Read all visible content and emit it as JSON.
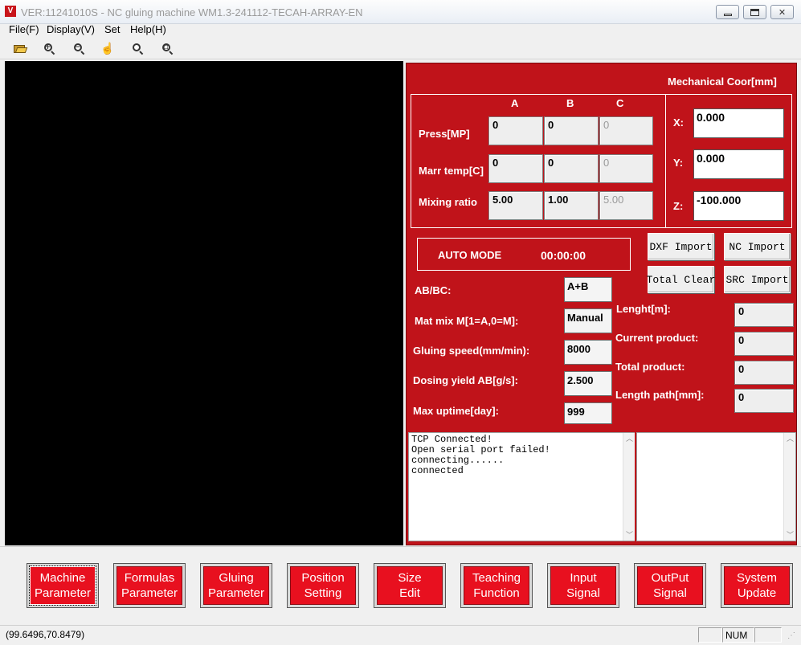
{
  "window": {
    "title": "VER:11241010S - NC gluing machine WM1.3-241112-TECAH-ARRAY-EN",
    "logo_letter": "V"
  },
  "menu": [
    "File(F)",
    "Display(V)",
    "Set",
    "Help(H)"
  ],
  "toolbar": [
    "open-folder-icon",
    "zoom-in-icon",
    "zoom-out-icon",
    "pan-hand-icon",
    "zoom-fit-icon",
    "zoom-window-icon"
  ],
  "mech": {
    "title": "Mechanical Coor[mm]",
    "x_label": "X:",
    "x": "0.000",
    "y_label": "Y:",
    "y": "0.000",
    "z_label": "Z:",
    "z": "-100.000"
  },
  "params": {
    "col_a": "A",
    "col_b": "B",
    "col_c": "C",
    "press_label": "Press[MP]",
    "press": [
      "0",
      "0",
      "0"
    ],
    "temp_label": "Marr temp[C]",
    "temp": [
      "0",
      "0",
      "0"
    ],
    "ratio_label": "Mixing ratio",
    "ratio": [
      "5.00",
      "1.00",
      "5.00"
    ]
  },
  "mode": {
    "label": "AUTO MODE",
    "time": "00:00:00"
  },
  "imports": {
    "dxf": "DXF Import",
    "nc": "NC Import",
    "total_clear": "Total Clear",
    "src": "SRC Import"
  },
  "settings": {
    "abbc_label": "AB/BC:",
    "abbc": "A+B",
    "matmix_label": "Mat mix M[1=A,0=M]:",
    "matmix": "Manual",
    "speed_label": "Gluing speed(mm/min):",
    "speed": "8000",
    "dosing_label": "Dosing yield AB[g/s]:",
    "dosing": "2.500",
    "uptime_label": "Max uptime[day]:",
    "uptime": "999"
  },
  "production": {
    "length_label": "Lenght[m]:",
    "length": "0",
    "current_label": "Current product:",
    "current": "0",
    "total_label": "Total product:",
    "total": "0",
    "path_label": "Length path[mm]:",
    "path": "0"
  },
  "log": [
    "TCP Connected!",
    "Open serial port failed!",
    "connecting......",
    "connected"
  ],
  "nav": [
    [
      "Machine",
      "Parameter"
    ],
    [
      "Formulas",
      "Parameter"
    ],
    [
      "Gluing",
      "Parameter"
    ],
    [
      "Position",
      "Setting"
    ],
    [
      "Size",
      "Edit"
    ],
    [
      "Teaching",
      "Function"
    ],
    [
      "Input",
      "Signal"
    ],
    [
      "OutPut",
      "Signal"
    ],
    [
      "System",
      "Update"
    ]
  ],
  "status": {
    "coords": "(99.6496,70.8479)",
    "num": "NUM"
  },
  "colors": {
    "panel_red": "#c0131a",
    "nav_red": "#e8101f",
    "canvas": "#000000"
  }
}
